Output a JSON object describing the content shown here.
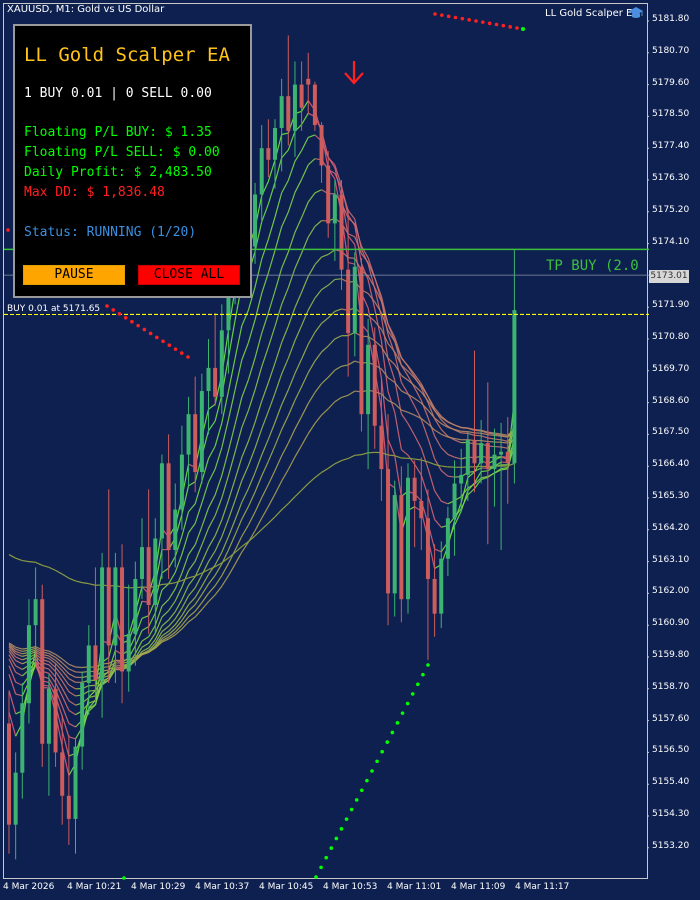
{
  "window": {
    "symbol_title": "XAUUSD, M1:  Gold vs US Dollar",
    "ea_name": "LL Gold Scalper EA",
    "ea_icon": "graduation-cap-icon"
  },
  "colors": {
    "background": "#0e2050",
    "bull": "#3cb371",
    "bear": "#cd5c5c",
    "accent": "#ffc31c",
    "profit_green": "#00ff00",
    "loss_red": "#ff2020",
    "status_blue": "#3a8fe0",
    "tp_line": "#3dbf3d",
    "entry_line": "#ffff00"
  },
  "y_axis_ticks": [
    "5181.80",
    "5180.70",
    "5179.60",
    "5178.50",
    "5177.40",
    "5176.30",
    "5175.20",
    "5174.10",
    "5171.90",
    "5170.80",
    "5169.70",
    "5168.60",
    "5167.50",
    "5166.40",
    "5165.30",
    "5164.20",
    "5163.10",
    "5162.00",
    "5160.90",
    "5159.80",
    "5158.70",
    "5157.60",
    "5156.50",
    "5155.40",
    "5154.30",
    "5153.20"
  ],
  "x_axis_ticks": [
    "4 Mar 2026",
    "4 Mar 10:21",
    "4 Mar 10:29",
    "4 Mar 10:37",
    "4 Mar 10:45",
    "4 Mar 10:53",
    "4 Mar 11:01",
    "4 Mar 11:09",
    "4 Mar 11:17"
  ],
  "current_price": "5173.01",
  "tp_label": "TP BUY (2.0",
  "entry_label": "BUY 0.01 at 5171.65",
  "panel": {
    "title": "LL Gold Scalper EA",
    "positions": "1 BUY 0.01 | 0 SELL 0.00",
    "floating_buy": "Floating P/L BUY: $ 1.35",
    "floating_sell": "Floating P/L SELL: $ 0.00",
    "daily_profit": "Daily Profit: $ 2,483.50",
    "max_dd": "Max DD: $ 1,836.48",
    "status": "Status: RUNNING (1/20)",
    "pause_label": "PAUSE",
    "close_all_label": "CLOSE ALL"
  },
  "chart_data": {
    "type": "candlestick",
    "symbol": "XAUUSD",
    "timeframe": "M1",
    "ylim": [
      5152.6,
      5182.4
    ],
    "price_lines": {
      "tp_buy": 5173.9,
      "entry_buy": 5171.65,
      "current": 5173.01
    },
    "candles": [
      {
        "o": 5157.5,
        "h": 5158.6,
        "l": 5153.0,
        "c": 5154.0
      },
      {
        "o": 5154.0,
        "h": 5156.5,
        "l": 5152.8,
        "c": 5155.8
      },
      {
        "o": 5155.8,
        "h": 5158.9,
        "l": 5154.9,
        "c": 5158.2
      },
      {
        "o": 5158.2,
        "h": 5161.8,
        "l": 5157.5,
        "c": 5160.9
      },
      {
        "o": 5160.9,
        "h": 5162.9,
        "l": 5159.6,
        "c": 5161.8
      },
      {
        "o": 5161.8,
        "h": 5162.3,
        "l": 5156.0,
        "c": 5156.8
      },
      {
        "o": 5156.8,
        "h": 5159.2,
        "l": 5155.0,
        "c": 5158.7
      },
      {
        "o": 5158.7,
        "h": 5159.6,
        "l": 5156.0,
        "c": 5156.5
      },
      {
        "o": 5156.5,
        "h": 5157.8,
        "l": 5154.0,
        "c": 5155.0
      },
      {
        "o": 5155.0,
        "h": 5157.1,
        "l": 5153.3,
        "c": 5154.2
      },
      {
        "o": 5154.2,
        "h": 5157.0,
        "l": 5153.0,
        "c": 5156.7
      },
      {
        "o": 5156.7,
        "h": 5159.3,
        "l": 5155.9,
        "c": 5158.9
      },
      {
        "o": 5158.9,
        "h": 5160.9,
        "l": 5157.8,
        "c": 5160.2
      },
      {
        "o": 5160.2,
        "h": 5162.9,
        "l": 5158.2,
        "c": 5159.0
      },
      {
        "o": 5159.0,
        "h": 5163.4,
        "l": 5157.7,
        "c": 5162.9
      },
      {
        "o": 5162.9,
        "h": 5165.6,
        "l": 5158.9,
        "c": 5160.2
      },
      {
        "o": 5160.2,
        "h": 5163.4,
        "l": 5158.9,
        "c": 5162.9
      },
      {
        "o": 5162.9,
        "h": 5163.7,
        "l": 5158.2,
        "c": 5159.3
      },
      {
        "o": 5159.3,
        "h": 5162.3,
        "l": 5158.6,
        "c": 5160.6
      },
      {
        "o": 5160.6,
        "h": 5163.1,
        "l": 5159.5,
        "c": 5162.5
      },
      {
        "o": 5162.5,
        "h": 5164.6,
        "l": 5161.8,
        "c": 5163.6
      },
      {
        "o": 5163.6,
        "h": 5165.6,
        "l": 5160.6,
        "c": 5161.6
      },
      {
        "o": 5161.6,
        "h": 5164.6,
        "l": 5160.6,
        "c": 5163.9
      },
      {
        "o": 5163.9,
        "h": 5166.8,
        "l": 5162.5,
        "c": 5166.5
      },
      {
        "o": 5166.5,
        "h": 5167.5,
        "l": 5162.5,
        "c": 5163.5
      },
      {
        "o": 5163.5,
        "h": 5165.8,
        "l": 5162.9,
        "c": 5164.9
      },
      {
        "o": 5164.9,
        "h": 5167.8,
        "l": 5164.2,
        "c": 5166.8
      },
      {
        "o": 5166.8,
        "h": 5168.8,
        "l": 5165.7,
        "c": 5168.2
      },
      {
        "o": 5168.2,
        "h": 5169.5,
        "l": 5165.5,
        "c": 5166.2
      },
      {
        "o": 5166.2,
        "h": 5169.6,
        "l": 5165.8,
        "c": 5169.0
      },
      {
        "o": 5169.0,
        "h": 5170.8,
        "l": 5167.5,
        "c": 5169.8
      },
      {
        "o": 5169.8,
        "h": 5171.7,
        "l": 5168.5,
        "c": 5168.8
      },
      {
        "o": 5168.8,
        "h": 5172.0,
        "l": 5168.2,
        "c": 5171.1
      },
      {
        "o": 5171.1,
        "h": 5174.0,
        "l": 5169.6,
        "c": 5173.4
      },
      {
        "o": 5173.4,
        "h": 5175.2,
        "l": 5172.0,
        "c": 5174.7
      },
      {
        "o": 5174.7,
        "h": 5176.4,
        "l": 5173.6,
        "c": 5175.7
      },
      {
        "o": 5175.7,
        "h": 5176.6,
        "l": 5173.2,
        "c": 5174.0
      },
      {
        "o": 5174.0,
        "h": 5176.2,
        "l": 5173.4,
        "c": 5175.8
      },
      {
        "o": 5175.8,
        "h": 5178.2,
        "l": 5174.9,
        "c": 5177.4
      },
      {
        "o": 5177.4,
        "h": 5178.4,
        "l": 5176.4,
        "c": 5177.0
      },
      {
        "o": 5177.0,
        "h": 5178.4,
        "l": 5176.0,
        "c": 5178.1
      },
      {
        "o": 5178.1,
        "h": 5179.8,
        "l": 5176.6,
        "c": 5179.2
      },
      {
        "o": 5179.2,
        "h": 5181.3,
        "l": 5177.5,
        "c": 5178.0
      },
      {
        "o": 5178.0,
        "h": 5180.4,
        "l": 5177.1,
        "c": 5179.6
      },
      {
        "o": 5179.6,
        "h": 5180.4,
        "l": 5178.0,
        "c": 5178.8
      },
      {
        "o": 5179.8,
        "h": 5180.7,
        "l": 5178.6,
        "c": 5179.6
      },
      {
        "o": 5179.6,
        "h": 5179.7,
        "l": 5178.0,
        "c": 5178.2
      },
      {
        "o": 5178.2,
        "h": 5178.3,
        "l": 5176.2,
        "c": 5176.8
      },
      {
        "o": 5176.8,
        "h": 5177.3,
        "l": 5174.3,
        "c": 5174.8
      },
      {
        "o": 5174.8,
        "h": 5176.3,
        "l": 5173.5,
        "c": 5175.8
      },
      {
        "o": 5175.8,
        "h": 5176.3,
        "l": 5172.5,
        "c": 5173.2
      },
      {
        "o": 5173.2,
        "h": 5175.3,
        "l": 5169.5,
        "c": 5171.0
      },
      {
        "o": 5171.0,
        "h": 5173.8,
        "l": 5170.2,
        "c": 5173.3
      },
      {
        "o": 5173.3,
        "h": 5173.6,
        "l": 5167.6,
        "c": 5168.2
      },
      {
        "o": 5168.2,
        "h": 5171.5,
        "l": 5166.3,
        "c": 5170.6
      },
      {
        "o": 5170.6,
        "h": 5171.2,
        "l": 5167.0,
        "c": 5167.8
      },
      {
        "o": 5167.8,
        "h": 5169.4,
        "l": 5165.2,
        "c": 5166.3
      },
      {
        "o": 5166.3,
        "h": 5168.2,
        "l": 5160.9,
        "c": 5162.0
      },
      {
        "o": 5162.0,
        "h": 5165.9,
        "l": 5161.2,
        "c": 5165.4
      },
      {
        "o": 5165.4,
        "h": 5166.4,
        "l": 5161.0,
        "c": 5161.8
      },
      {
        "o": 5161.8,
        "h": 5166.5,
        "l": 5161.3,
        "c": 5166.0
      },
      {
        "o": 5166.0,
        "h": 5166.6,
        "l": 5163.6,
        "c": 5165.2
      },
      {
        "o": 5165.2,
        "h": 5166.7,
        "l": 5163.5,
        "c": 5164.6
      },
      {
        "o": 5164.6,
        "h": 5165.6,
        "l": 5159.7,
        "c": 5162.5
      },
      {
        "o": 5162.5,
        "h": 5163.7,
        "l": 5160.5,
        "c": 5161.3
      },
      {
        "o": 5161.3,
        "h": 5163.8,
        "l": 5160.8,
        "c": 5163.2
      },
      {
        "o": 5163.2,
        "h": 5165.0,
        "l": 5162.6,
        "c": 5164.6
      },
      {
        "o": 5164.6,
        "h": 5166.6,
        "l": 5163.3,
        "c": 5165.8
      },
      {
        "o": 5165.8,
        "h": 5167.0,
        "l": 5164.8,
        "c": 5166.1
      },
      {
        "o": 5166.1,
        "h": 5167.6,
        "l": 5165.2,
        "c": 5167.3
      },
      {
        "o": 5167.3,
        "h": 5170.4,
        "l": 5165.5,
        "c": 5166.5
      },
      {
        "o": 5166.5,
        "h": 5168.0,
        "l": 5165.8,
        "c": 5167.2
      },
      {
        "o": 5167.2,
        "h": 5169.3,
        "l": 5163.7,
        "c": 5166.3
      },
      {
        "o": 5166.3,
        "h": 5167.7,
        "l": 5165.0,
        "c": 5166.8
      },
      {
        "o": 5166.8,
        "h": 5167.9,
        "l": 5163.5,
        "c": 5166.9
      },
      {
        "o": 5166.9,
        "h": 5168.1,
        "l": 5165.1,
        "c": 5166.5
      },
      {
        "o": 5166.5,
        "h": 5173.9,
        "l": 5165.8,
        "c": 5171.8
      }
    ]
  }
}
